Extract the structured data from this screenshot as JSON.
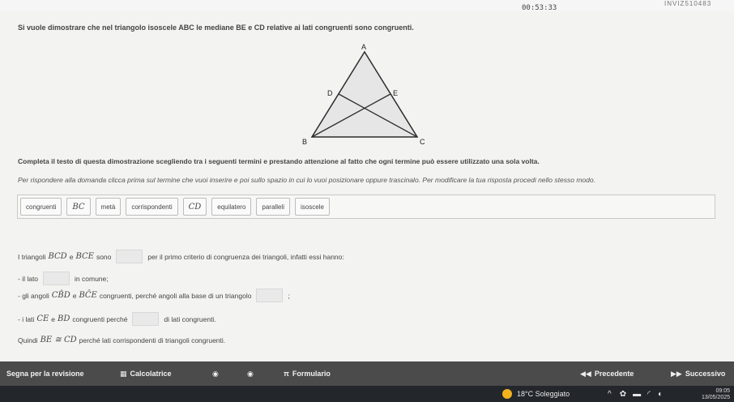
{
  "header": {
    "timer": "00:53:33",
    "top_right_code": "INVIZ510483"
  },
  "statement": "Si vuole dimostrare che nel triangolo isoscele ABC le mediane BE e CD relative ai lati congruenti sono congruenti.",
  "figure": {
    "labels": {
      "A": "A",
      "B": "B",
      "C": "C",
      "D": "D",
      "E": "E"
    },
    "fill_color": "#e6e6e6",
    "line_color": "#2c2c2c"
  },
  "instructions": {
    "line1": "Completa il testo di questa dimostrazione scegliendo tra i seguenti termini e prestando attenzione al fatto che ogni termine può essere utilizzato una sola volta.",
    "line2": "Per rispondere alla domanda clicca prima sul termine che vuoi inserire e poi sullo spazio in cui lo vuoi posizionare oppure trascinalo. Per modificare la tua risposta procedi nello stesso modo."
  },
  "word_bank": [
    {
      "label": "congruenti",
      "math": false
    },
    {
      "label": "BC",
      "math": true
    },
    {
      "label": "metà",
      "math": false
    },
    {
      "label": "corrispondenti",
      "math": false
    },
    {
      "label": "CD",
      "math": true
    },
    {
      "label": "equilatero",
      "math": false
    },
    {
      "label": "paralleli",
      "math": false
    },
    {
      "label": "isoscele",
      "math": false
    }
  ],
  "proof": {
    "l1_a": "I triangoli",
    "l1_m1": "BCD",
    "l1_b": "e",
    "l1_m2": "BCE",
    "l1_c": "sono",
    "l1_d": "per il primo criterio di congruenza dei triangoli, infatti essi hanno:",
    "l2_a": "- il lato",
    "l2_b": "in comune;",
    "l3_a": "- gli angoli",
    "l3_m1": "CB̂D",
    "l3_b": "e",
    "l3_m2": "BĈE",
    "l3_c": "congruenti, perché angoli alla base di un triangolo",
    "l3_d": ";",
    "l4_a": "- i lati",
    "l4_m1": "CE",
    "l4_b": "e",
    "l4_m2": "BD",
    "l4_c": "congruenti perché",
    "l4_d": "di lati congruenti.",
    "l5_a": "Quindi",
    "l5_m": "BE ≅ CD",
    "l5_b": "perché lati corrispondenti di triangoli congruenti."
  },
  "bottom_bar": {
    "review": "Segna per la revisione",
    "calculator": "Calcolatrice",
    "formulary": "Formulario",
    "previous": "Precedente",
    "next": "Successivo"
  },
  "taskbar": {
    "weather": "18°C  Soleggiato",
    "time": "09:05",
    "date": "13/05/2025"
  }
}
